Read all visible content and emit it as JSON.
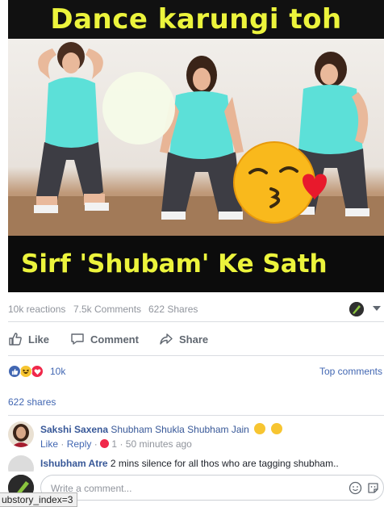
{
  "post": {
    "meme_top_text": "Dance karungi toh",
    "meme_bottom_text": "Sirf 'Shubam' Ke Sath"
  },
  "meta": {
    "reactions": "10k reactions",
    "comments": "7.5k Comments",
    "shares": "622 Shares"
  },
  "actions": {
    "like": "Like",
    "comment": "Comment",
    "share": "Share"
  },
  "reactions_row": {
    "count": "10k",
    "top_comments": "Top comments",
    "icons": [
      "like-icon",
      "haha-icon",
      "love-icon"
    ]
  },
  "shares_line": "622 shares",
  "comments": [
    {
      "author": "Sakshi Saxena",
      "tags": "Shubham Shukla Shubham Jain",
      "text": "",
      "like_label": "Like",
      "reply_label": "Reply",
      "reaction_count": "1",
      "time": "50 minutes ago"
    },
    {
      "author": "Ishubham Atre",
      "tags": "",
      "text": "2 mins silence for all thos who are tagging shubham.."
    }
  ],
  "composer": {
    "placeholder": "Write a comment..."
  },
  "status_tip": "ubstory_index=3",
  "colors": {
    "meme_text": "#ecf43c",
    "link": "#385898",
    "accent": "#4267b2",
    "muted": "#90949c",
    "top_color": "#5ce0d8"
  }
}
